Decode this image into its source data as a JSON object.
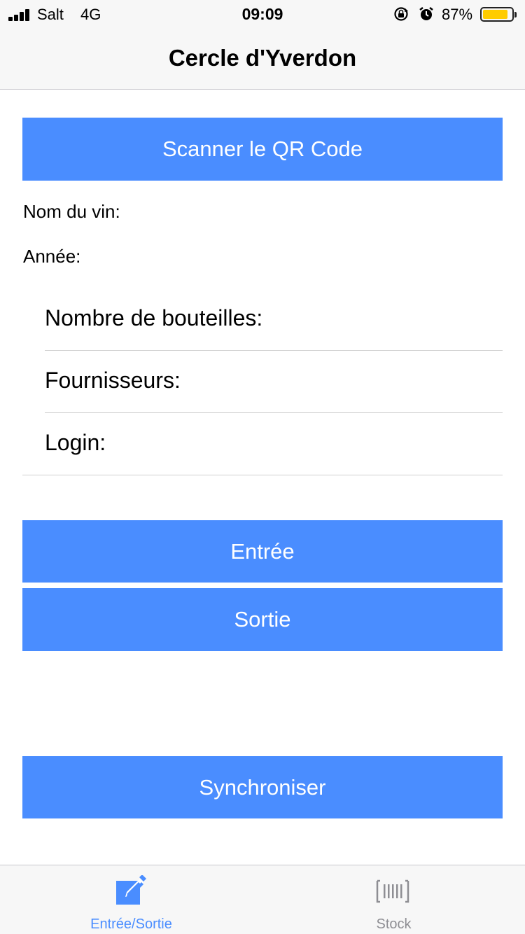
{
  "status_bar": {
    "carrier": "Salt",
    "network": "4G",
    "time": "09:09",
    "battery_percent": "87%",
    "battery_level": 0.87,
    "battery_color": "#ffcc00"
  },
  "nav": {
    "title": "Cercle d'Yverdon"
  },
  "main": {
    "scan_button": "Scanner le QR Code",
    "wine_name_label": "Nom du vin:",
    "year_label": "Année:",
    "form_rows": [
      "Nombre de bouteilles:",
      "Fournisseurs:",
      "Login:"
    ],
    "entree_button": "Entrée",
    "sortie_button": "Sortie",
    "sync_button": "Synchroniser"
  },
  "tab_bar": {
    "tabs": [
      {
        "label": "Entrée/Sortie",
        "icon": "edit-icon",
        "active": true
      },
      {
        "label": "Stock",
        "icon": "barcode-icon",
        "active": false
      }
    ]
  },
  "colors": {
    "accent": "#4a8dff",
    "inactive": "#8e8e93"
  }
}
